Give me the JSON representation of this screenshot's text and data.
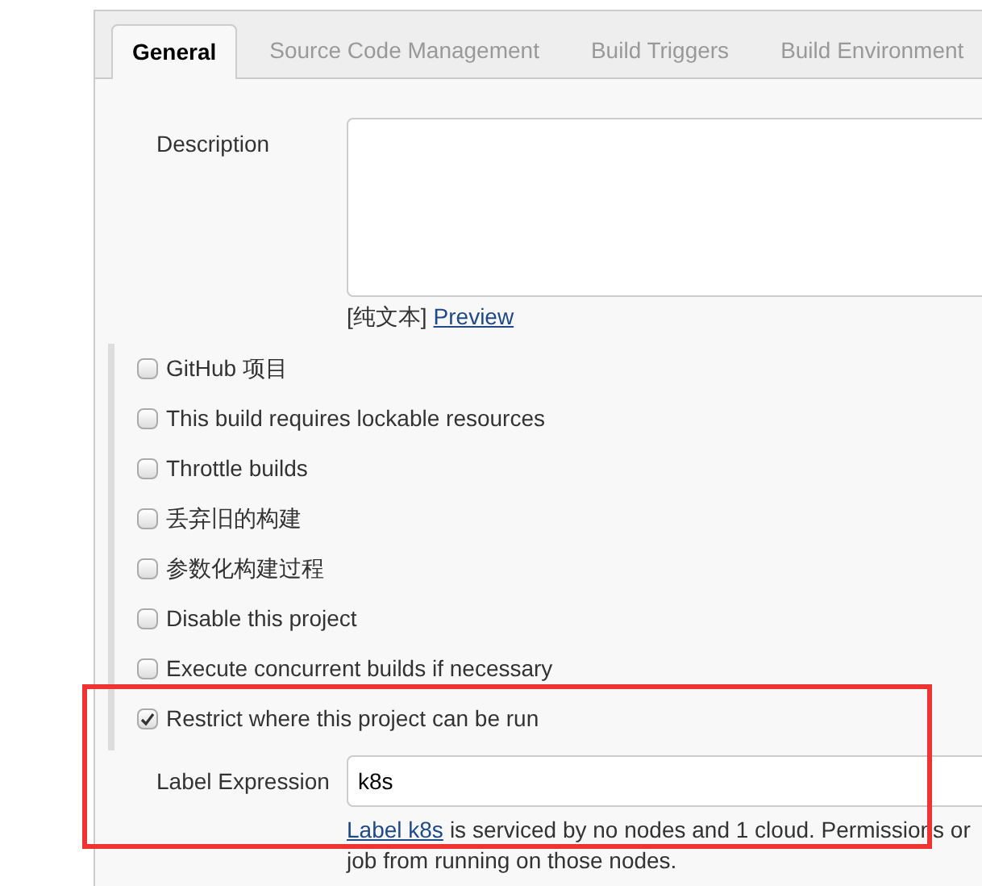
{
  "tabs": [
    {
      "label": "General",
      "selected": true
    },
    {
      "label": "Source Code Management",
      "selected": false
    },
    {
      "label": "Build Triggers",
      "selected": false
    },
    {
      "label": "Build Environment",
      "selected": false
    }
  ],
  "description": {
    "label": "Description",
    "format_note": "[纯文本]",
    "preview_link": "Preview"
  },
  "options": [
    {
      "label": "GitHub 项目",
      "checked": false
    },
    {
      "label": "This build requires lockable resources",
      "checked": false
    },
    {
      "label": "Throttle builds",
      "checked": false
    },
    {
      "label": "丢弃旧的构建",
      "checked": false
    },
    {
      "label": "参数化构建过程",
      "checked": false
    },
    {
      "label": "Disable this project",
      "checked": false
    },
    {
      "label": "Execute concurrent builds if necessary",
      "checked": false
    },
    {
      "label": "Restrict where this project can be run",
      "checked": true
    }
  ],
  "label_expression": {
    "label": "Label Expression",
    "value": "k8s",
    "hint_link": "Label k8s",
    "hint_text": "is serviced by no nodes and 1 cloud. Permissions or",
    "hint_text_2": "job from running on those nodes."
  }
}
